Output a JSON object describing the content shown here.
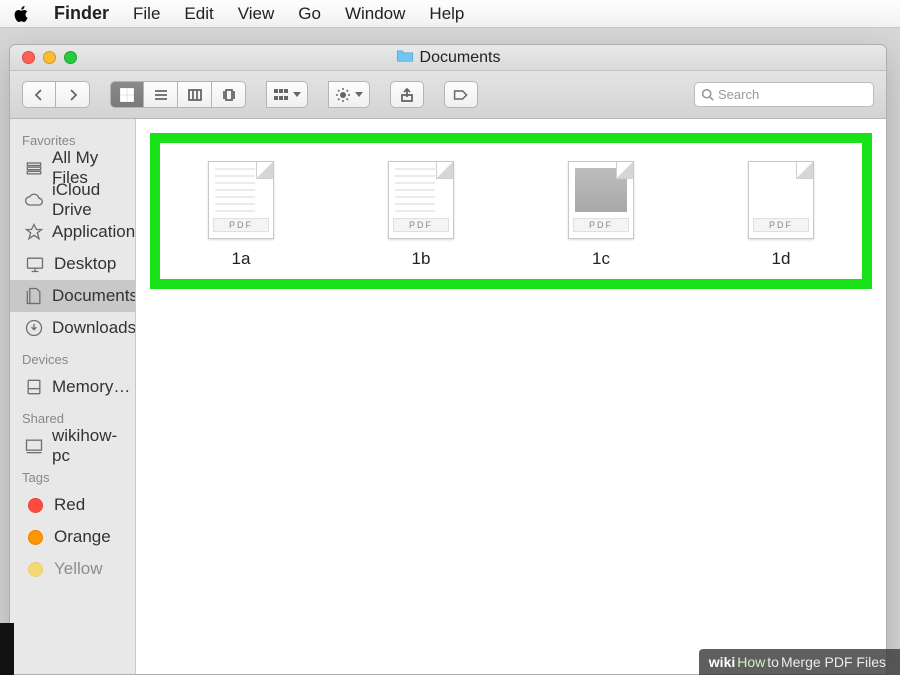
{
  "menubar": {
    "app": "Finder",
    "items": [
      "File",
      "Edit",
      "View",
      "Go",
      "Window",
      "Help"
    ]
  },
  "window": {
    "title": "Documents"
  },
  "toolbar": {
    "search_placeholder": "Search"
  },
  "sidebar": {
    "sections": [
      {
        "heading": "Favorites",
        "items": [
          {
            "label": "All My Files",
            "icon": "all-my-files",
            "selected": false
          },
          {
            "label": "iCloud Drive",
            "icon": "cloud",
            "selected": false
          },
          {
            "label": "Applications",
            "icon": "applications",
            "selected": false
          },
          {
            "label": "Desktop",
            "icon": "desktop",
            "selected": false
          },
          {
            "label": "Documents",
            "icon": "documents",
            "selected": true
          },
          {
            "label": "Downloads",
            "icon": "downloads",
            "selected": false
          }
        ]
      },
      {
        "heading": "Devices",
        "items": [
          {
            "label": "Memory…",
            "icon": "drive",
            "eject": true
          }
        ]
      },
      {
        "heading": "Shared",
        "items": [
          {
            "label": "wikihow-pc",
            "icon": "pc"
          }
        ]
      },
      {
        "heading": "Tags",
        "items": [
          {
            "label": "Red",
            "tag": "red"
          },
          {
            "label": "Orange",
            "tag": "orange"
          },
          {
            "label": "Yellow",
            "tag": "yellow"
          }
        ]
      }
    ]
  },
  "files": [
    {
      "name": "1a",
      "type": "PDF"
    },
    {
      "name": "1b",
      "type": "PDF"
    },
    {
      "name": "1c",
      "type": "PDF",
      "dark": true
    },
    {
      "name": "1d",
      "type": "PDF"
    }
  ],
  "caption": {
    "brand_prefix": "wiki",
    "brand_suffix": "How",
    "separator": " to ",
    "title": "Merge PDF Files"
  }
}
